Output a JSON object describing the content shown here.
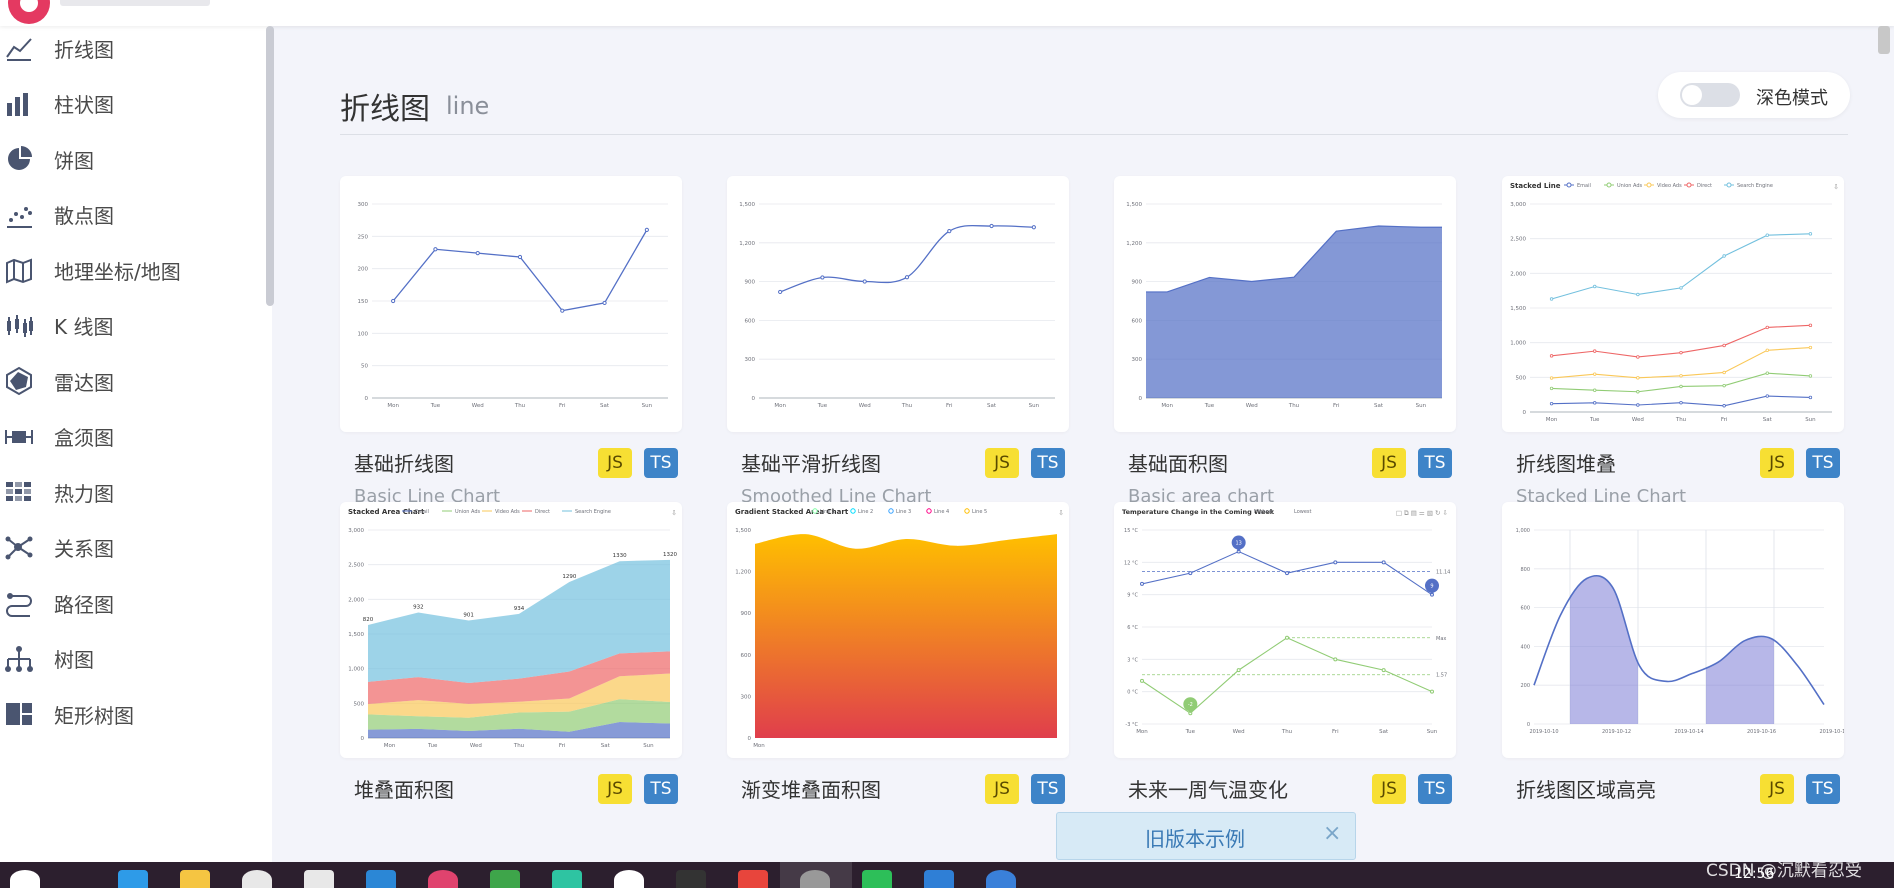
{
  "page": {
    "title": "折线图",
    "subtitle": "line",
    "dark_mode_label": "深色模式",
    "dark_mode_on": false
  },
  "sidebar": {
    "items": [
      {
        "label": "折线图",
        "icon": "line-chart-icon"
      },
      {
        "label": "柱状图",
        "icon": "bar-chart-icon"
      },
      {
        "label": "饼图",
        "icon": "pie-chart-icon"
      },
      {
        "label": "散点图",
        "icon": "scatter-chart-icon"
      },
      {
        "label": "地理坐标/地图",
        "icon": "map-icon"
      },
      {
        "label": "K 线图",
        "icon": "candlestick-icon"
      },
      {
        "label": "雷达图",
        "icon": "radar-chart-icon"
      },
      {
        "label": "盒须图",
        "icon": "boxplot-icon"
      },
      {
        "label": "热力图",
        "icon": "heatmap-icon"
      },
      {
        "label": "关系图",
        "icon": "graph-icon"
      },
      {
        "label": "路径图",
        "icon": "path-icon"
      },
      {
        "label": "树图",
        "icon": "tree-icon"
      },
      {
        "label": "矩形树图",
        "icon": "treemap-icon"
      }
    ]
  },
  "cards": [
    {
      "name": "基础折线图",
      "sub": "Basic Line Chart",
      "js": "JS",
      "ts": "TS"
    },
    {
      "name": "基础平滑折线图",
      "sub": "Smoothed Line Chart",
      "js": "JS",
      "ts": "TS"
    },
    {
      "name": "基础面积图",
      "sub": "Basic area chart",
      "js": "JS",
      "ts": "TS"
    },
    {
      "name": "折线图堆叠",
      "sub": "Stacked Line Chart",
      "js": "JS",
      "ts": "TS"
    },
    {
      "name": "堆叠面积图",
      "sub": "",
      "js": "JS",
      "ts": "TS"
    },
    {
      "name": "渐变堆叠面积图",
      "sub": "",
      "js": "JS",
      "ts": "TS"
    },
    {
      "name": "未来一周气温变化",
      "sub": "",
      "js": "JS",
      "ts": "TS"
    },
    {
      "name": "折线图区域高亮",
      "sub": "",
      "js": "JS",
      "ts": "TS"
    }
  ],
  "thumbs": {
    "basic_line": {
      "x": [
        "Mon",
        "Tue",
        "Wed",
        "Thu",
        "Fri",
        "Sat",
        "Sun"
      ],
      "y": [
        150,
        230,
        224,
        218,
        135,
        147,
        260
      ],
      "yticks": [
        "0",
        "50",
        "100",
        "150",
        "200",
        "250",
        "300"
      ],
      "ymax": 300
    },
    "smooth_line": {
      "x": [
        "Mon",
        "Tue",
        "Wed",
        "Thu",
        "Fri",
        "Sat",
        "Sun"
      ],
      "y": [
        820,
        932,
        901,
        934,
        1290,
        1330,
        1320
      ],
      "yticks": [
        "0",
        "300",
        "600",
        "900",
        "1,200",
        "1,500"
      ],
      "ymax": 1500
    },
    "area": {
      "x": [
        "Mon",
        "Tue",
        "Wed",
        "Thu",
        "Fri",
        "Sat",
        "Sun"
      ],
      "y": [
        820,
        932,
        901,
        934,
        1290,
        1330,
        1320
      ],
      "yticks": [
        "0",
        "300",
        "600",
        "900",
        "1,200",
        "1,500"
      ],
      "ymax": 1500
    },
    "stacked_line": {
      "title": "Stacked Line",
      "legend": [
        "Email",
        "Union Ads",
        "Video Ads",
        "Direct",
        "Search Engine"
      ],
      "colors": [
        "#5470c6",
        "#91cc75",
        "#fac858",
        "#ee6666",
        "#73c0de"
      ],
      "x": [
        "Mon",
        "Tue",
        "Wed",
        "Thu",
        "Fri",
        "Sat",
        "Sun"
      ],
      "series": [
        [
          120,
          132,
          101,
          134,
          90,
          230,
          210
        ],
        [
          220,
          182,
          191,
          234,
          290,
          330,
          310
        ],
        [
          150,
          232,
          201,
          154,
          190,
          330,
          410
        ],
        [
          320,
          332,
          301,
          334,
          390,
          330,
          320
        ],
        [
          820,
          932,
          901,
          934,
          1290,
          1330,
          1320
        ]
      ],
      "yticks": [
        "0",
        "500",
        "1,000",
        "1,500",
        "2,000",
        "2,500",
        "3,000"
      ],
      "ymax": 3000
    },
    "stacked_area": {
      "title": "Stacked Area Chart",
      "legend": [
        "Email",
        "Union Ads",
        "Video Ads",
        "Direct",
        "Search Engine"
      ],
      "colors": [
        "#5470c6",
        "#91cc75",
        "#fac858",
        "#ee6666",
        "#73c0de"
      ],
      "labels": [
        "820",
        "932",
        "901",
        "934",
        "1290",
        "1330",
        "1320"
      ],
      "yticks": [
        "0",
        "500",
        "1,000",
        "1,500",
        "2,000",
        "2,500",
        "3,000"
      ],
      "x": [
        "Mon",
        "Tue",
        "Wed",
        "Thu",
        "Fri",
        "Sat",
        "Sun"
      ]
    },
    "gradient_area": {
      "title": "Gradient Stacked Area Chart",
      "legend": [
        "Line 1",
        "Line 2",
        "Line 3",
        "Line 4",
        "Line 5"
      ],
      "colors": [
        "#80ffa5",
        "#00ddff",
        "#37a2ff",
        "#ff0087",
        "#ffbf00"
      ],
      "yticks": [
        "0",
        "300",
        "600",
        "900",
        "1,200",
        "1,500"
      ],
      "x": [
        "Mon"
      ]
    },
    "temperature": {
      "title": "Temperature Change in the Coming Week",
      "legend": [
        "Highest",
        "Lowest"
      ],
      "x": [
        "Mon",
        "Tue",
        "Wed",
        "Thu",
        "Fri",
        "Sat",
        "Sun"
      ],
      "high": [
        10,
        11,
        13,
        11,
        12,
        12,
        9
      ],
      "low": [
        1,
        -2,
        2,
        5,
        3,
        2,
        0
      ],
      "yticks": [
        "-3 °C",
        "0 °C",
        "3 °C",
        "6 °C",
        "9 °C",
        "12 °C",
        "15 °C"
      ],
      "markers": [
        "13",
        "9",
        "-2"
      ],
      "marklines": [
        "11.14",
        "Max",
        "1.57"
      ]
    },
    "area_pieces": {
      "x": [
        "2019-10-10",
        "2019-10-12",
        "2019-10-14",
        "2019-10-16",
        "2019-10-18"
      ],
      "yticks": [
        "0",
        "200",
        "400",
        "600",
        "800",
        "1,000"
      ]
    }
  },
  "old_banner": {
    "text": "旧版本示例",
    "close": "×"
  },
  "watermark": "CSDN @沉默看忍受",
  "clock": "12:56",
  "taskbar_icons": [
    "start-icon",
    "edge-icon",
    "folder-icon",
    "store-icon",
    "mail-icon",
    "vscode-icon",
    "intellij-icon",
    "android-studio-icon",
    "pycharm-icon",
    "notepad-icon",
    "terminal-icon",
    "chrome-icon",
    "user-app-icon",
    "wechat-icon",
    "app-icon",
    "browser-icon"
  ]
}
